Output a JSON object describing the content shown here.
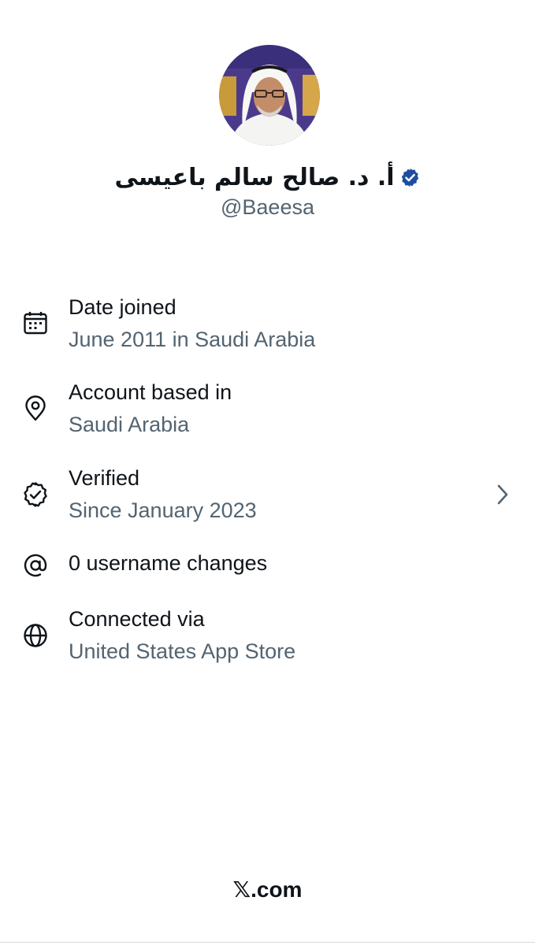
{
  "profile": {
    "display_name": "أ. د. صالح سالم باعيسى",
    "handle": "@Baeesa",
    "verified_badge_color": "#1d4ea0"
  },
  "info_items": [
    {
      "icon": "calendar-icon",
      "title": "Date joined",
      "subtitle": "June 2011 in Saudi Arabia"
    },
    {
      "icon": "location-pin-icon",
      "title": "Account based in",
      "subtitle": "Saudi Arabia"
    },
    {
      "icon": "verified-check-icon",
      "title": "Verified",
      "subtitle": "Since January 2023",
      "has_chevron": true
    },
    {
      "icon": "at-sign-icon",
      "title": "0 username changes"
    },
    {
      "icon": "globe-icon",
      "title": "Connected via",
      "subtitle": "United States App Store"
    }
  ],
  "footer": {
    "brand": "𝕏.com"
  },
  "colors": {
    "primary_text": "#0f1419",
    "secondary_text": "#536471"
  }
}
